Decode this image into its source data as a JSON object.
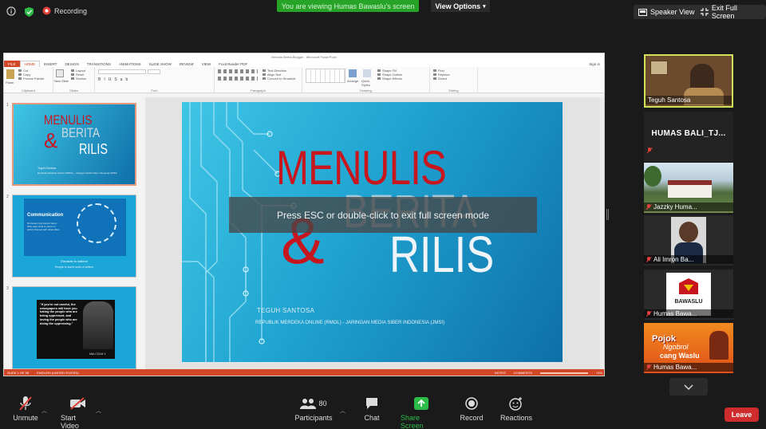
{
  "top": {
    "recording": "Recording",
    "viewing_banner": "You are viewing Humas Bawaslu's screen",
    "view_options": "View Options",
    "speaker_view": "Speaker View",
    "exit_full_screen": "Exit Full Screen"
  },
  "ppt": {
    "title": "Menulis Berita Blogger - Microsoft PowerPoint",
    "tabs": [
      "FILE",
      "HOME",
      "INSERT",
      "DESIGN",
      "TRANSITIONS",
      "ANIMATIONS",
      "SLIDE SHOW",
      "REVIEW",
      "VIEW",
      "Foxit Reader PDF"
    ],
    "signin": "Sign in",
    "groups": [
      "Clipboard",
      "Slides",
      "Font",
      "Paragraph",
      "Drawing",
      "Editing"
    ],
    "ribbon": {
      "paste": "Paste",
      "cut": "Cut",
      "copy": "Copy",
      "format_painter": "Format Painter",
      "new_slide": "New Slide",
      "layout": "Layout",
      "reset": "Reset",
      "section": "Section",
      "text_direction": "Text Direction",
      "align_text": "Align Text",
      "convert_smartart": "Convert to SmartArt",
      "arrange": "Arrange",
      "quick_styles": "Quick Styles",
      "shape_fill": "Shape Fill",
      "shape_outline": "Shape Outline",
      "shape_effects": "Shape Effects",
      "find": "Find",
      "replace": "Replace",
      "select": "Select"
    },
    "thumbs": [
      {
        "num": "1",
        "l1": "MENULIS",
        "l2": "BERITA",
        "amp": "&",
        "l3": "RILIS",
        "foot1": "Teguh Santosa",
        "foot2": "Republik Merdeka Online (RMOL) - Jaringan Media Siber Indonesia (JMSI)"
      },
      {
        "num": "2",
        "head": "Communication",
        "body": "Rumusan nya hampir sama: Who says what to whom in which channel with what effect",
        "f1": "Emosian is indirect",
        "f2": "People to some sorts of writers"
      },
      {
        "num": "3",
        "quote": "\"If you're not careful, the newspapers will have you hating the people who are being oppressed, and loving the people who are doing the oppressing.\"",
        "author": "MALCOLM X"
      }
    ],
    "status_left": "SLIDE 1 OF 35",
    "status_lang": "ENGLISH (UNITED STATES)",
    "status_notes": "NOTES",
    "status_comments": "COMMENTS",
    "status_zoom": "74%",
    "slide": {
      "line1": "MENULIS",
      "line2": "BERITA",
      "amp": "&",
      "line3": "RILIS",
      "author": "TEGUH SANTOSA",
      "org": "REPUBLIK MERDEKA ONLINE (RMOL) - JARINGAN MEDIA SIBER INDONESIA (JMSI)"
    }
  },
  "overlay": "Press ESC or double-click to exit full screen mode",
  "participants_panel": [
    {
      "name": "Teguh Santosa",
      "muted": false
    },
    {
      "name": "HUMAS BALI_TJ...",
      "muted": true
    },
    {
      "name": "Jazzky Huma...",
      "muted": true
    },
    {
      "name": "Ali Imron Ba...",
      "muted": true
    },
    {
      "name": "Humas Bawa...",
      "muted": true,
      "logo": "BAWASLU"
    },
    {
      "name": "Humas Bawa...",
      "muted": true,
      "poster_l1": "Pojok",
      "poster_l2": "Ngobrol",
      "poster_l3": "cang Waslu"
    }
  ],
  "bottom": {
    "unmute": "Unmute",
    "start_video": "Start Video",
    "participants": "Participants",
    "participants_count": "80",
    "chat": "Chat",
    "share_screen": "Share Screen",
    "record": "Record",
    "reactions": "Reactions",
    "leave": "Leave"
  },
  "colors": {
    "zoom_green": "#27a327",
    "leave_red": "#cf2d2d",
    "ppt_orange": "#d24726",
    "slide_red": "#c8161f"
  }
}
